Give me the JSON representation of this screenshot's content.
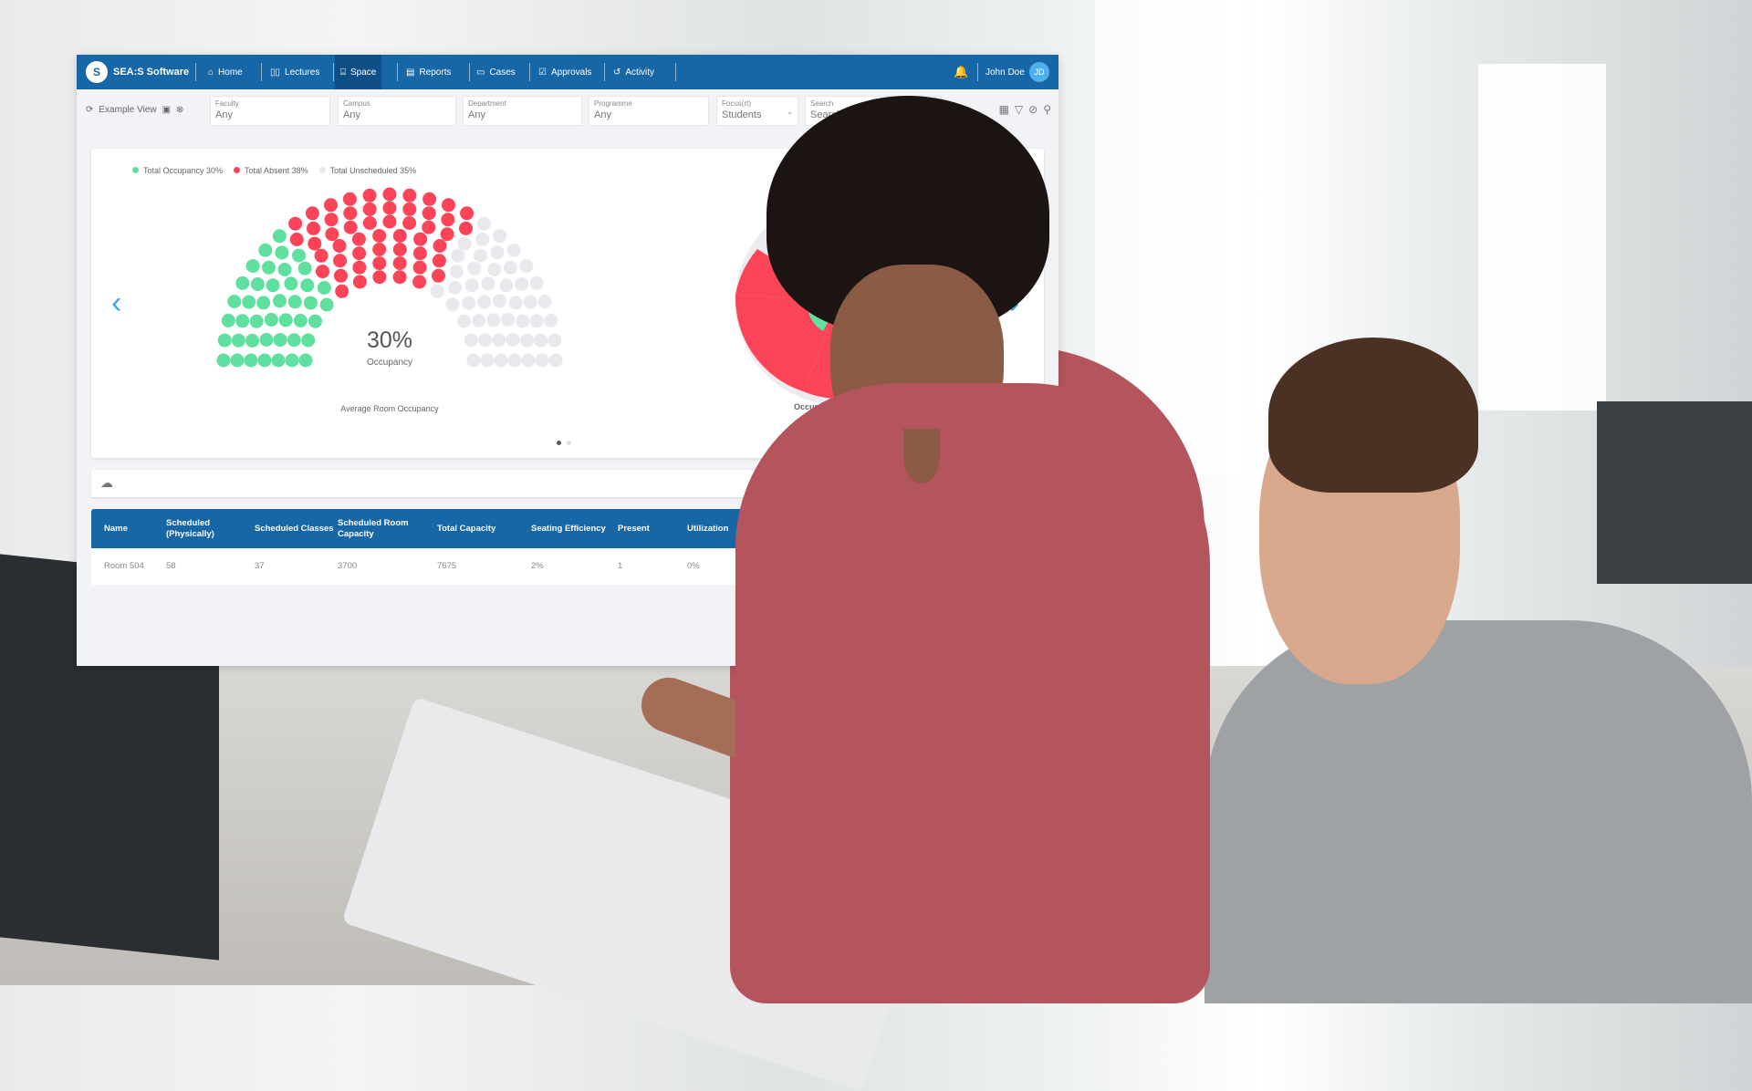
{
  "nav": {
    "brand": "SEA:S Software",
    "items": [
      {
        "label": "Home",
        "icon": "home-icon"
      },
      {
        "label": "Lectures",
        "icon": "book-icon"
      },
      {
        "label": "Space",
        "icon": "building-icon",
        "active": true
      },
      {
        "label": "Reports",
        "icon": "report-icon"
      },
      {
        "label": "Cases",
        "icon": "folder-icon"
      },
      {
        "label": "Approvals",
        "icon": "calendar-check-icon"
      },
      {
        "label": "Activity",
        "icon": "history-icon"
      }
    ],
    "user": "John Doe",
    "avatar": "JD"
  },
  "filters": {
    "view": "Example View",
    "fields": [
      {
        "label": "Faculty",
        "value": "Any"
      },
      {
        "label": "Campus",
        "value": "Any"
      },
      {
        "label": "Department",
        "value": "Any"
      },
      {
        "label": "Programme",
        "value": "Any"
      },
      {
        "label": "Focus(rt)",
        "value": "Students"
      },
      {
        "label": "Search",
        "placeholder": "Search"
      }
    ]
  },
  "chart_data": [
    {
      "type": "parliament",
      "legend": [
        {
          "label": "Total Occupancy 30%",
          "value": 30,
          "color": "#5fe09f"
        },
        {
          "label": "Total Absent 38%",
          "value": 38,
          "color": "#fb4458"
        },
        {
          "label": "Total Unscheduled 35%",
          "value": 35,
          "color": "#e8e9ec"
        }
      ],
      "center_value": "30%",
      "center_label": "Occupancy",
      "title": "Average Room Occupancy"
    },
    {
      "type": "pie",
      "title": "Occupan"
    }
  ],
  "carousel": {
    "pages": 2,
    "current": 1
  },
  "table": {
    "columns": [
      "Name",
      "Scheduled (Physically)",
      "Scheduled Classes",
      "Scheduled Room Capacity",
      "Total Capacity",
      "Seating Efficiency",
      "Present",
      "Utilization"
    ],
    "rows": [
      [
        "Room 504",
        "58",
        "37",
        "3700",
        "7675",
        "2%",
        "1",
        "0%"
      ]
    ]
  }
}
